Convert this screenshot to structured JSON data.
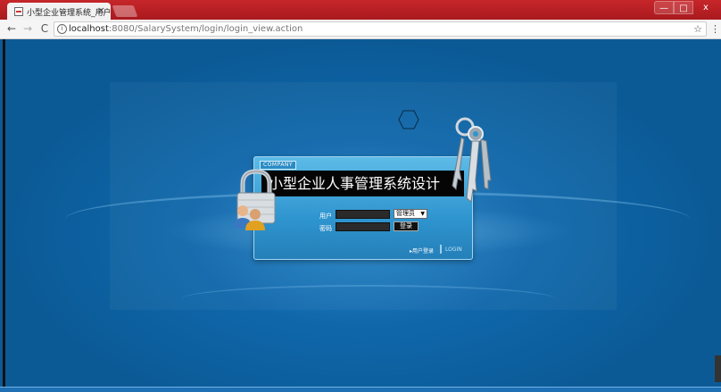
{
  "browser": {
    "tab_title": "小型企业管理系统_用户登录",
    "tab_close": "×",
    "url_host": "localhost",
    "url_rest": ":8080/SalarySystem/login/login_view.action",
    "back_icon": "←",
    "forward_icon": "→",
    "reload_icon": "C",
    "info_icon": "i",
    "star_icon": "☆",
    "menu_icon": "⋮",
    "window_controls": {
      "minimize": "—",
      "maximize": "□",
      "close": "x"
    }
  },
  "login": {
    "company_badge": "COMPANY",
    "system_title": "小型企业人事管理系统设计",
    "username_label": "用户",
    "password_label": "密码",
    "role_selected": "管理员",
    "role_arrow": "▼",
    "login_button": "登录",
    "user_login_link": "▸用户登录",
    "login_en": "LOGIN"
  },
  "colors": {
    "page_bg": "#0b5a96",
    "panel_bg": "#2f95cf",
    "title_bar_bg": "#050505",
    "chrome_title": "#c6262a"
  }
}
